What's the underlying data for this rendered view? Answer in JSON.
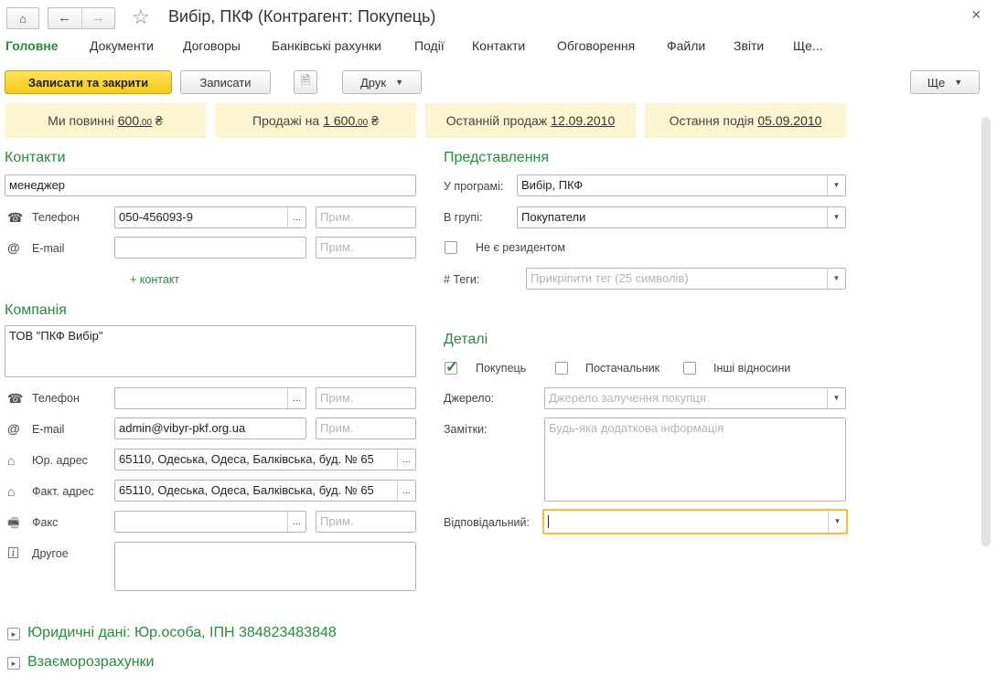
{
  "window": {
    "title": "Вибір, ПКФ (Контрагент: Покупець)",
    "home_icon": "home-icon",
    "back_icon": "arrow-left-icon",
    "forward_icon": "arrow-right-icon",
    "favorite_icon": "star-icon",
    "close_icon": "close-icon"
  },
  "tabs": [
    "Головне",
    "Документи",
    "Договоры",
    "Банківські рахунки",
    "Події",
    "Контакти",
    "Обговорення",
    "Файли",
    "Звіти",
    "Ще..."
  ],
  "toolbar": {
    "save_close": "Записати та закрити",
    "save": "Записати",
    "print": "Друк",
    "more": "Ще"
  },
  "info_bar": {
    "owe_label": "Ми повинні",
    "owe_value": "600",
    "owe_cents": ",00",
    "sales_label": "Продажі на",
    "sales_value": "1 600",
    "sales_cents": ",00",
    "currency": "₴",
    "last_sale_label": "Останній продаж",
    "last_sale_value": "12.09.2010",
    "last_event_label": "Остання подія",
    "last_event_value": "05.09.2010"
  },
  "contacts": {
    "heading": "Контакти",
    "role": "менеджер",
    "phone_label": "Телефон",
    "phone_value": "050-456093-9",
    "email_label": "E-mail",
    "email_value": "",
    "note_placeholder": "Прим.",
    "add_contact": "+ контакт"
  },
  "company": {
    "heading": "Компанія",
    "name": "ТОВ \"ПКФ Вибір\"",
    "phone_label": "Телефон",
    "phone_value": "",
    "email_label": "E-mail",
    "email_value": "admin@vibyr-pkf.org.ua",
    "legal_address_label": "Юр. адрес",
    "legal_address_value": "65110, Одеська, Одеса, Балківська, буд. № 65",
    "actual_address_label": "Факт. адрес",
    "actual_address_value": "65110, Одеська, Одеса, Балківська, буд. № 65",
    "fax_label": "Факс",
    "fax_value": "",
    "other_label": "Другое",
    "other_value": "",
    "note_placeholder": "Прим."
  },
  "representation": {
    "heading": "Представлення",
    "in_program_label": "У програмі:",
    "in_program_value": "Вибір, ПКФ",
    "in_group_label": "В групі:",
    "in_group_value": "Покупатели",
    "non_resident_label": "Не є резидентом",
    "non_resident_checked": false,
    "tags_label": "# Теги:",
    "tags_placeholder": "Прикріпити тег (25 символів)"
  },
  "details": {
    "heading": "Деталі",
    "buyer_label": "Покупець",
    "buyer_checked": true,
    "supplier_label": "Постачальник",
    "supplier_checked": false,
    "other_rel_label": "Інші відносини",
    "other_rel_checked": false,
    "source_label": "Джерело:",
    "source_placeholder": "Джерело залучення покупця",
    "notes_label": "Замітки:",
    "notes_placeholder": "Будь-яка додаткова інформація",
    "responsible_label": "Відповідальний:",
    "responsible_value": ""
  },
  "groups": {
    "legal": "Юридичні дані: Юр.особа, ІПН 384823483848",
    "settlements": "Взаєморозрахунки"
  },
  "colors": {
    "accent_green": "#2a8a3b",
    "primary_yellow": "#f5c718",
    "info_bg": "#fcf5cf",
    "focus_border": "#f0c040"
  }
}
